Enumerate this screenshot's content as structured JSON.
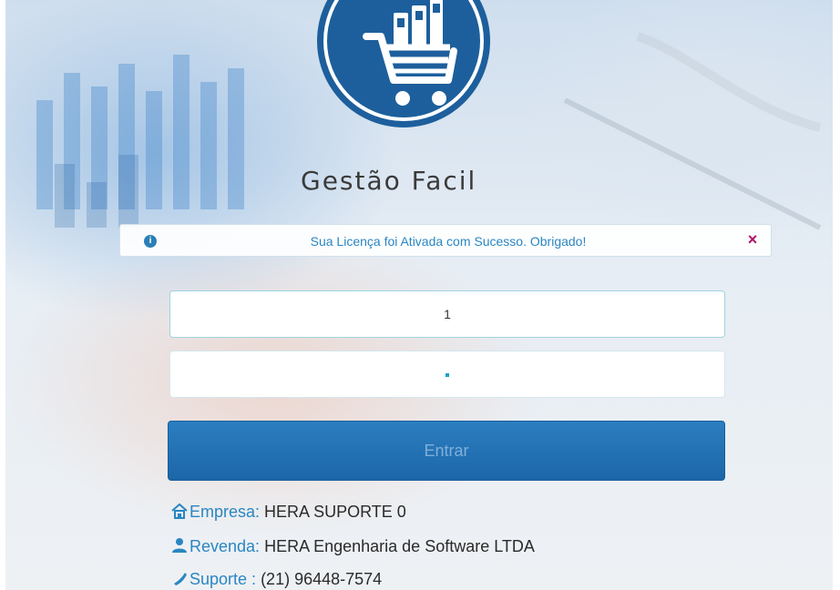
{
  "brand": {
    "name": "Gestão Facil"
  },
  "alert": {
    "icon": "info-icon",
    "message": "Sua Licença foi Ativada com Sucesso. Obrigado!",
    "close_glyph": "×"
  },
  "login": {
    "username_value": "1",
    "password_value": "•",
    "submit_label": "Entrar"
  },
  "footer": {
    "empresa_label": "Empresa:",
    "empresa_value": "HERA SUPORTE 0",
    "revenda_label": "Revenda:",
    "revenda_value": "HERA Engenharia de Software LTDA",
    "suporte_label": "Suporte :",
    "suporte_value": "(21) 96448-7574"
  },
  "colors": {
    "primary": "#1c66a8",
    "accent": "#2a86c2",
    "close": "#b3126a"
  }
}
